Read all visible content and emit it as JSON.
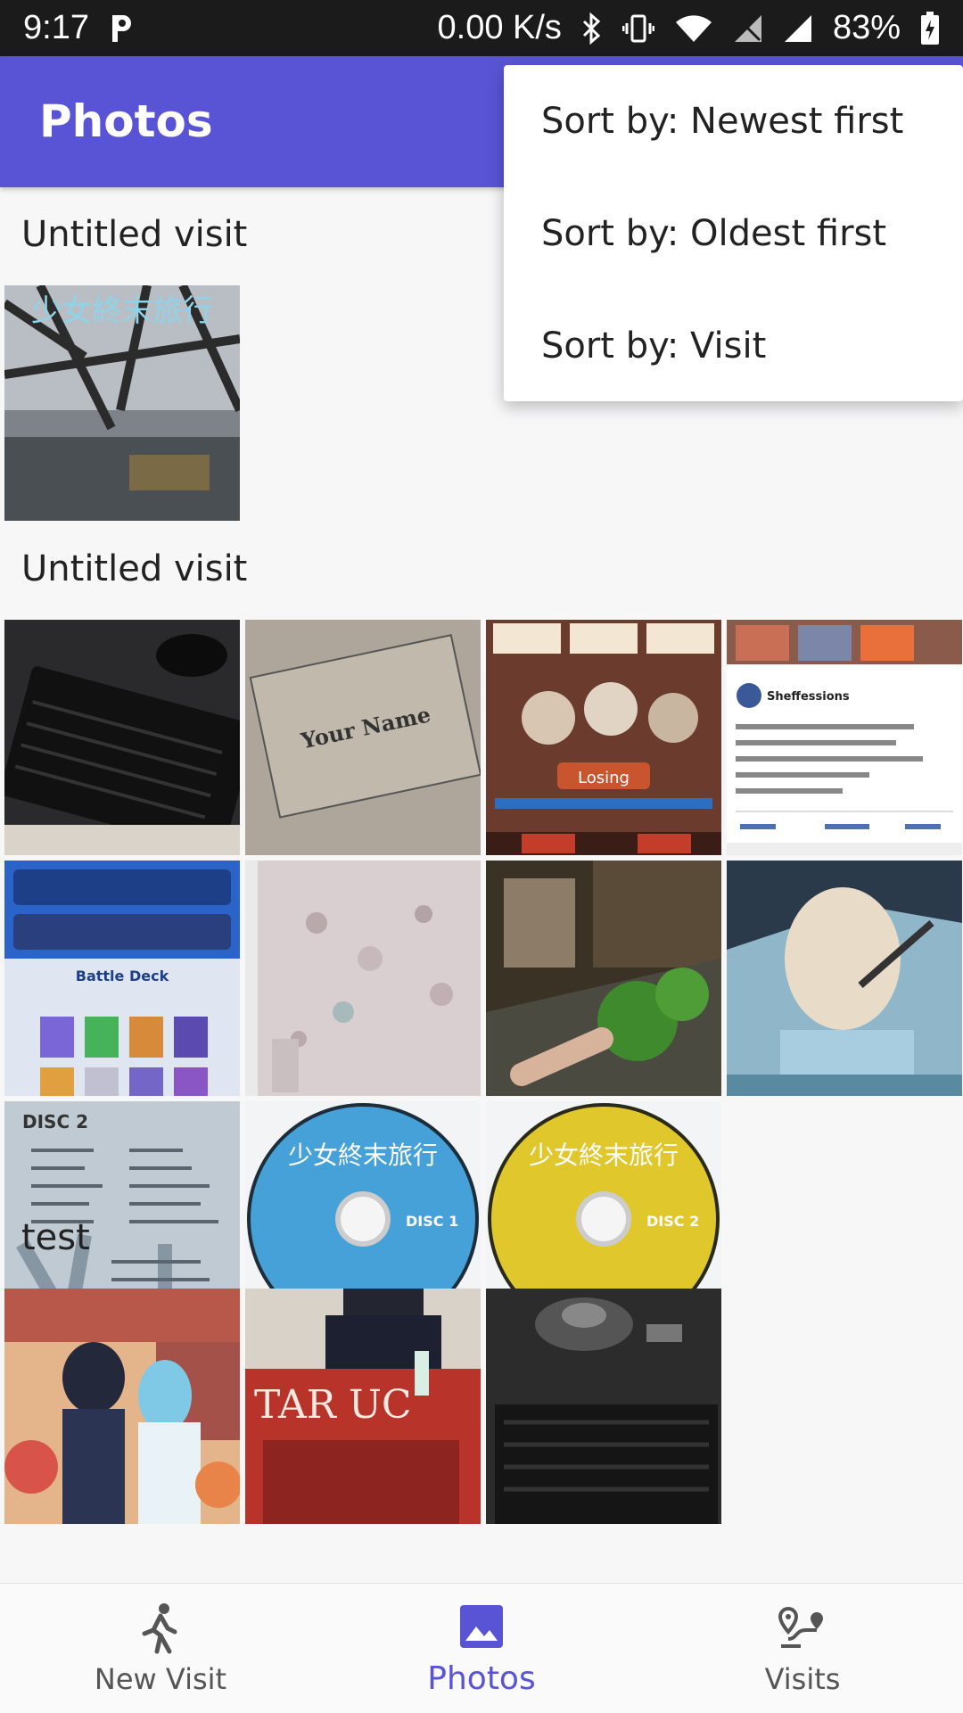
{
  "status_bar": {
    "time": "9:17",
    "net_speed": "0.00 K/s",
    "battery": "83%"
  },
  "app_bar": {
    "title": "Photos"
  },
  "menu": {
    "items": [
      "Sort by: Newest first",
      "Sort by: Oldest first",
      "Sort by: Visit"
    ]
  },
  "sections": [
    {
      "title": "Untitled visit"
    },
    {
      "title": "Untitled visit"
    },
    {
      "title": "test"
    }
  ],
  "photo_texts": {
    "your_name": "Your Name",
    "battle_deck": "Battle Deck",
    "disc2_header": "DISC 2",
    "disc1_label": "DISC 1",
    "disc2_label": "DISC 2",
    "tar_uc": "TAR UC",
    "losing": "Losing",
    "sheffessions": "Sheffessions"
  },
  "bottom_nav": {
    "items": [
      {
        "label": "New Visit",
        "icon": "walking-person-icon",
        "active": false
      },
      {
        "label": "Photos",
        "icon": "photo-icon",
        "active": true
      },
      {
        "label": "Visits",
        "icon": "route-icon",
        "active": false
      }
    ]
  },
  "colors": {
    "accent": "#5954d6",
    "status_bar": "#1b1b1b",
    "background": "#f7f7f8"
  }
}
